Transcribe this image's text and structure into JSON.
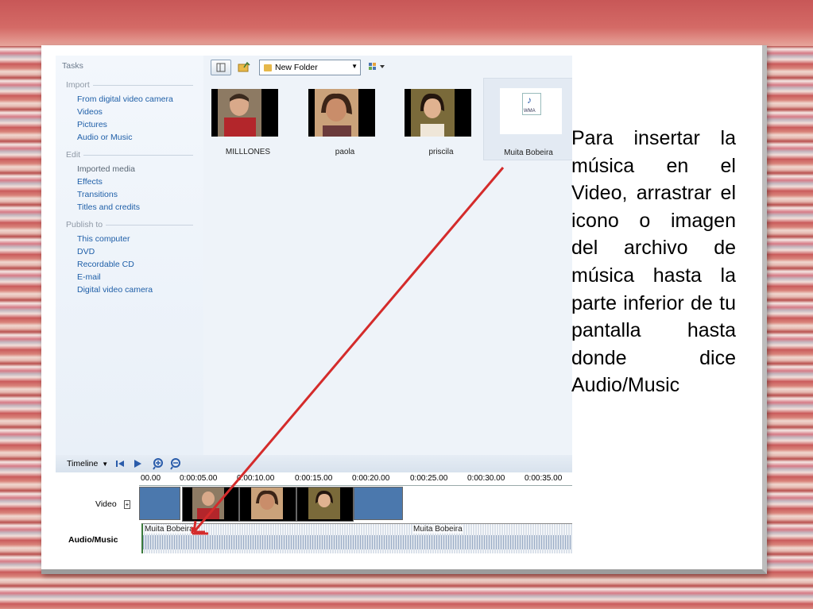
{
  "tasks": {
    "title": "Tasks",
    "import": {
      "heading": "Import",
      "items": [
        "From digital video camera",
        "Videos",
        "Pictures",
        "Audio or Music"
      ]
    },
    "edit": {
      "heading": "Edit",
      "items": [
        "Imported media",
        "Effects",
        "Transitions",
        "Titles and credits"
      ]
    },
    "publish": {
      "heading": "Publish to",
      "items": [
        "This computer",
        "DVD",
        "Recordable CD",
        "E-mail",
        "Digital video camera"
      ]
    }
  },
  "toolbar": {
    "folder": "New Folder"
  },
  "clips": [
    {
      "label": "MILLLONES"
    },
    {
      "label": "paola"
    },
    {
      "label": "priscila"
    },
    {
      "label": "Muita Bobeira",
      "icon_text": "WMA"
    }
  ],
  "timeline": {
    "label": "Timeline",
    "ruler": [
      "00.00",
      "0:00:05.00",
      "0:00:10.00",
      "0:00:15.00",
      "0:00:20.00",
      "0:00:25.00",
      "0:00:30.00",
      "0:00:35.00"
    ],
    "video_label": "Video",
    "audio_label": "Audio/Music",
    "audio_clips": [
      "Muita Bobeira",
      "Muita Bobeira"
    ]
  },
  "caption": "Para insertar la música en el Video, arrastrar el icono o imagen del archivo de música hasta la parte inferior de tu pantalla hasta donde dice Audio/Music",
  "colors": {
    "arrow": "#d42b2b",
    "link": "#1f5fa8"
  }
}
